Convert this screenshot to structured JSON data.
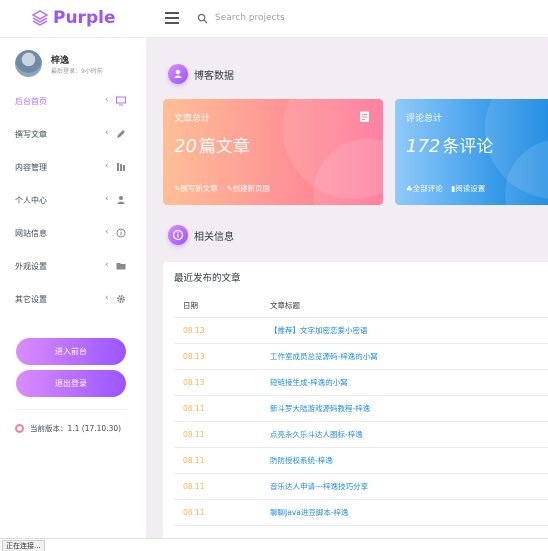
{
  "brand": {
    "name": "Purple",
    "icon": "layers-icon",
    "color": "#9a55ff"
  },
  "search": {
    "placeholder": "Search projects"
  },
  "profile": {
    "name": "梓逸",
    "last_login": "最后登录：9小时前"
  },
  "sidebar": {
    "items": [
      {
        "label": "后台首页",
        "icon": "monitor-icon",
        "active": true
      },
      {
        "label": "撰写文章",
        "icon": "pencil-icon",
        "active": false
      },
      {
        "label": "内容管理",
        "icon": "books-icon",
        "active": false
      },
      {
        "label": "个人中心",
        "icon": "user-icon",
        "active": false
      },
      {
        "label": "网站信息",
        "icon": "info-icon",
        "active": false
      },
      {
        "label": "外观设置",
        "icon": "folder-icon",
        "active": false
      },
      {
        "label": "其它设置",
        "icon": "gear-icon",
        "active": false
      }
    ],
    "enter_button": "进入前台",
    "logout_button": "退出登录",
    "version": "当前版本：1.1 (17.10.30)"
  },
  "main": {
    "blog_section_title": "博客数据",
    "related_section_title": "相关信息",
    "card_articles": {
      "title": "文章总计",
      "count": "20",
      "unit": "篇文章",
      "link1": "撰写新文章",
      "link2": "创建新页面",
      "icon": "document-icon"
    },
    "card_comments": {
      "title": "评论总计",
      "count": "172",
      "unit": "条评论",
      "link1": "全部评论",
      "link2": "阅读设置"
    },
    "recent": {
      "title": "最近发布的文章",
      "col_date": "日期",
      "col_title": "文章标题",
      "rows": [
        {
          "date": "08.13",
          "title": "【推荐】文字加密恋爱小密语"
        },
        {
          "date": "08.13",
          "title": "工作室成员总览源码-梓逸的小窝"
        },
        {
          "date": "08.13",
          "title": "短链接生成-梓逸的小窝"
        },
        {
          "date": "08.11",
          "title": "新斗罗大陆游戏源码教程-梓逸"
        },
        {
          "date": "08.11",
          "title": "点亮永久乐斗达人图标-梓逸"
        },
        {
          "date": "08.11",
          "title": "防防授权系统-梓逸"
        },
        {
          "date": "08.11",
          "title": "音乐达人申请---梓逸技巧分享"
        },
        {
          "date": "08.11",
          "title": "聊聊Java进豆脚本-梓逸"
        }
      ]
    }
  },
  "status": {
    "text": "正在连接..."
  },
  "colors": {
    "accent": "#b66dff",
    "orange_start": "#ffbf96",
    "orange_end": "#fe7096",
    "blue_start": "#90caf9",
    "blue_end": "#047edf",
    "date": "#f6b44f",
    "link": "#198ae3"
  }
}
